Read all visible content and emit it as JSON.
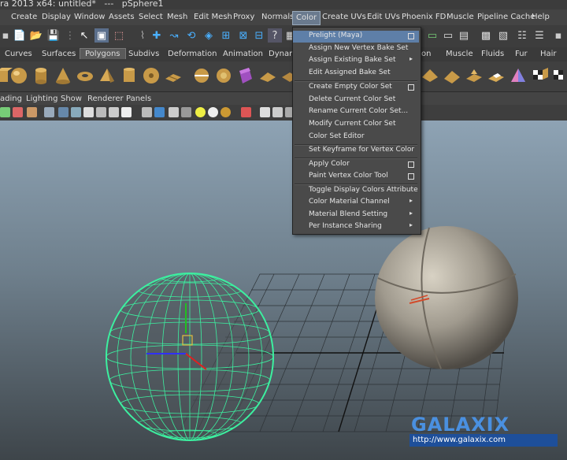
{
  "window": {
    "title": "ra 2013 x64: untitled*   ---   pSphere1"
  },
  "menubar": {
    "items": [
      "Create",
      "Display",
      "Window",
      "Assets",
      "Select",
      "Mesh",
      "Edit Mesh",
      "Proxy",
      "Normals",
      "Color",
      "Create UVs",
      "Edit UVs",
      "Phoenix FD",
      "Muscle",
      "Pipeline Cache",
      "Help"
    ],
    "active": "Color"
  },
  "shelf_tabs": {
    "items": [
      "Curves",
      "Surfaces",
      "Polygons",
      "Subdivs",
      "Deformation",
      "Animation",
      "Dynami",
      "on",
      "Muscle",
      "Fluids",
      "Fur",
      "Hair"
    ],
    "active": "Polygons"
  },
  "panel_menu": {
    "items": [
      "ading",
      "Lighting",
      "Show",
      "Renderer",
      "Panels"
    ]
  },
  "color_menu": {
    "items": [
      {
        "label": "Prelight (Maya)",
        "option": true,
        "highlighted": true
      },
      {
        "label": "Assign New Vertex Bake Set"
      },
      {
        "label": "Assign Existing Bake Set",
        "submenu": true
      },
      {
        "label": "Edit Assigned Bake Set"
      },
      {
        "label": "Create Empty Color Set",
        "option": true
      },
      {
        "label": "Delete Current Color Set"
      },
      {
        "label": "Rename Current Color Set..."
      },
      {
        "label": "Modify Current Color Set"
      },
      {
        "label": "Color Set Editor"
      },
      {
        "label": "Set Keyframe for Vertex Color"
      },
      {
        "label": "Apply Color",
        "option": true
      },
      {
        "label": "Paint Vertex Color Tool",
        "option": true
      },
      {
        "label": "Toggle Display Colors Attribute"
      },
      {
        "label": "Color Material Channel",
        "submenu": true
      },
      {
        "label": "Material Blend Setting",
        "submenu": true
      },
      {
        "label": "Per Instance Sharing",
        "submenu": true
      }
    ]
  },
  "watermark": {
    "brand": "GALAXIX",
    "url": "http://www.galaxix.com"
  },
  "colors": {
    "menu_highlight": "#5e7fa8",
    "wireframe": "#3cf0a0",
    "logo_blue": "#4a90e0"
  }
}
